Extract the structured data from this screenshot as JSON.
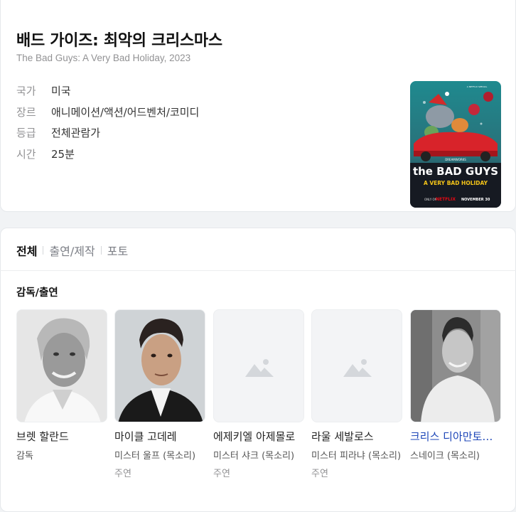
{
  "movie": {
    "title": "배드 가이즈: 최악의 크리스마스",
    "subtitle": "The Bad Guys: A Very Bad Holiday, 2023",
    "info": [
      {
        "key": "국가",
        "value": "미국"
      },
      {
        "key": "장르",
        "value": "애니메이션/액션/어드벤처/코미디"
      },
      {
        "key": "등급",
        "value": "전체관람가"
      },
      {
        "key": "시간",
        "value": "25분"
      }
    ],
    "poster": {
      "top_text": "A NETFLIX SPECIAL",
      "brand": "DREAMWORKS",
      "title_line1": "the BAD GUYS",
      "title_line2": "A VERY BAD HOLIDAY",
      "only_on": "ONLY ON",
      "service": "NETFLIX",
      "date": "NOVEMBER 30"
    }
  },
  "tabs": [
    {
      "label": "전체",
      "active": true
    },
    {
      "label": "출연/제작",
      "active": false
    },
    {
      "label": "포토",
      "active": false
    }
  ],
  "cast_section": {
    "title": "감독/출연",
    "people": [
      {
        "name": "브렛 할란드",
        "role": "감독",
        "type": ""
      },
      {
        "name": "마이클 고데레",
        "role": "미스터 울프 (목소리)",
        "type": "주연"
      },
      {
        "name": "에제키엘 아제몰로",
        "role": "미스터 샤크 (목소리)",
        "type": "주연"
      },
      {
        "name": "라울 세발로스",
        "role": "미스터 피라냐 (목소리)",
        "type": "주연"
      },
      {
        "name": "크리스 디아만토폴로스",
        "role": "스네이크 (목소리)",
        "type": ""
      }
    ]
  },
  "colors": {
    "link": "#1d46b8",
    "muted": "#929294",
    "background": "#f1f3f5"
  }
}
